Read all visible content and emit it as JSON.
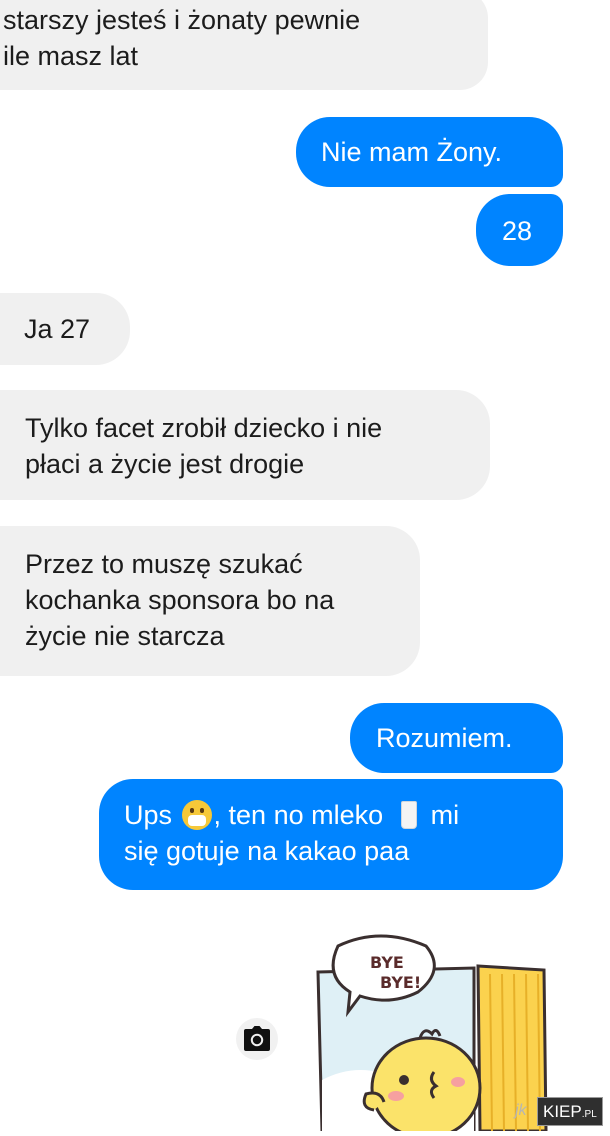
{
  "conversation": {
    "messages": [
      {
        "direction": "incoming",
        "lines": [
          "starszy jesteś i żonaty pewnie",
          "ile masz lat"
        ]
      },
      {
        "direction": "outgoing",
        "lines": [
          "Nie mam Żony."
        ]
      },
      {
        "direction": "outgoing",
        "lines": [
          "28"
        ]
      },
      {
        "direction": "incoming",
        "lines": [
          "Ja 27"
        ]
      },
      {
        "direction": "incoming",
        "lines": [
          "Tylko facet zrobił dziecko i nie",
          "płaci a życie jest drogie"
        ]
      },
      {
        "direction": "incoming",
        "lines": [
          "Przez to muszę szukać",
          "kochanka sponsora bo na",
          "życie nie starcza"
        ]
      },
      {
        "direction": "outgoing",
        "lines": [
          "Rozumiem."
        ]
      },
      {
        "direction": "outgoing",
        "segments": {
          "start": "Ups",
          "middle": ", ten no mleko",
          "end": "mi"
        },
        "line2": "się gotuje na kakao paa",
        "emoji": [
          "face-with-medical-mask",
          "glass-of-milk"
        ]
      }
    ]
  },
  "sticker": {
    "speech_text_1": "BYE",
    "speech_text_2": "BYE!",
    "icon": "yellow-chick-waving-sticker"
  },
  "composer": {
    "icon": "camera-icon"
  },
  "watermark": {
    "dim_text": "jk",
    "brand_text": "KIEP",
    "suffix": ".PL"
  },
  "colors": {
    "outgoing_bubble": "#0084ff",
    "incoming_bubble": "#f0f0f0",
    "incoming_text": "#1c1c1c"
  }
}
